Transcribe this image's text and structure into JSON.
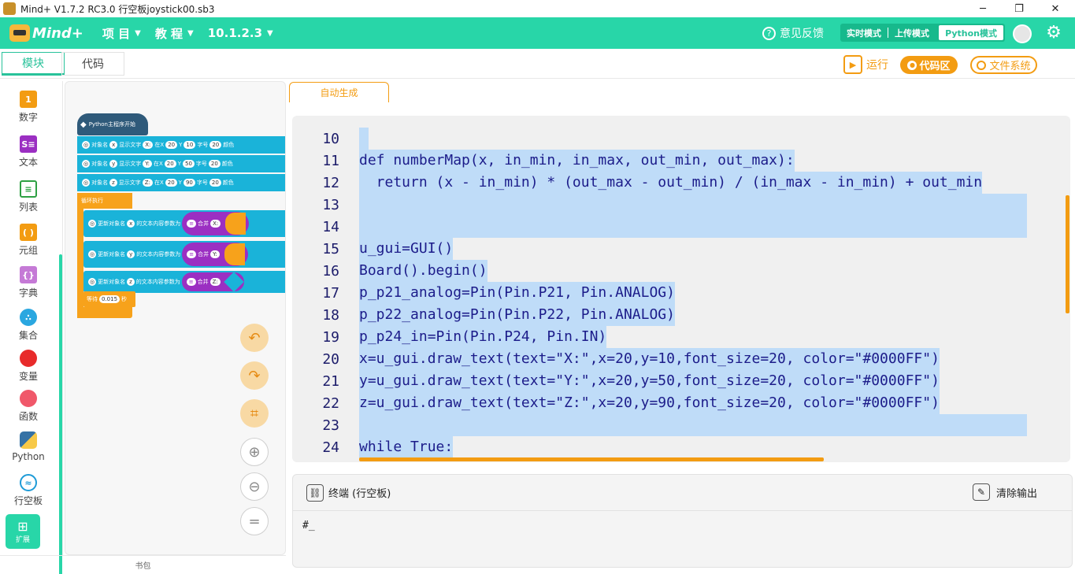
{
  "window": {
    "title": "Mind+ V1.7.2 RC3.0   行空板joystick00.sb3",
    "minimize": "─",
    "maximize": "❐",
    "close": "✕"
  },
  "menubar": {
    "logo_text": "Mind+",
    "project": "项 目",
    "tutorial": "教 程",
    "version": "10.1.2.3",
    "feedback": "意见反馈",
    "modes": [
      "实时模式",
      "上传模式",
      "Python模式"
    ],
    "active_mode": "Python模式"
  },
  "tabs": {
    "blocks": "模块",
    "code": "代码"
  },
  "toolbar": {
    "run": "运行",
    "code_area": "代码区",
    "file_system": "文件系统"
  },
  "categories": [
    {
      "label": "数字",
      "icon": "number-icon",
      "color": "#f39c12"
    },
    {
      "label": "文本",
      "icon": "text-icon",
      "color": "#9b2fc2"
    },
    {
      "label": "列表",
      "icon": "list-icon",
      "color": "#2ea043"
    },
    {
      "label": "元组",
      "icon": "tuple-icon",
      "color": "#f39c12"
    },
    {
      "label": "字典",
      "icon": "dict-icon",
      "color": "#c57ad6"
    },
    {
      "label": "集合",
      "icon": "set-icon",
      "color": "#2aa7e0"
    },
    {
      "label": "变量",
      "icon": "variable-icon",
      "color": "#e82b2b"
    },
    {
      "label": "函数",
      "icon": "function-icon",
      "color": "#f0586a"
    },
    {
      "label": "Python",
      "icon": "python-icon",
      "color": "#3572a5"
    },
    {
      "label": "行空板",
      "icon": "unihiker-icon",
      "color": "#1e9bd7"
    }
  ],
  "extension_label": "扩展",
  "blocks": {
    "hat": "Python主程序开始",
    "text_rows": [
      {
        "obj": "x",
        "label": "对象名",
        "show": "显示文字",
        "text": "X:",
        "at": "在X",
        "x": "20",
        "y_label": "Y",
        "y": "10",
        "size_label": "字号",
        "size": "20",
        "color_label": "颜色"
      },
      {
        "obj": "y",
        "label": "对象名",
        "show": "显示文字",
        "text": "Y:",
        "at": "在X",
        "x": "20",
        "y_label": "Y",
        "y": "50",
        "size_label": "字号",
        "size": "20",
        "color_label": "颜色"
      },
      {
        "obj": "z",
        "label": "对象名",
        "show": "显示文字",
        "text": "Z:",
        "at": "在X",
        "x": "20",
        "y_label": "Y",
        "y": "90",
        "size_label": "字号",
        "size": "20",
        "color_label": "颜色"
      }
    ],
    "loop": "循环执行",
    "update_rows": [
      {
        "label": "更新对象名",
        "obj": "x",
        "param": "的文本内容参数为",
        "merge": "合并",
        "val": "X:"
      },
      {
        "label": "更新对象名",
        "obj": "y",
        "param": "的文本内容参数为",
        "merge": "合并",
        "val": "Y:"
      },
      {
        "label": "更新对象名",
        "obj": "z",
        "param": "的文本内容参数为",
        "merge": "合并",
        "val": "Z:"
      }
    ],
    "wait_label": "等待",
    "wait_value": "0.015",
    "wait_unit": "秒"
  },
  "bookbag": "书包",
  "code_tab": "自动生成",
  "code_lines": [
    {
      "n": "10",
      "text": " "
    },
    {
      "n": "11",
      "text": "def numberMap(x, in_min, in_max, out_min, out_max):"
    },
    {
      "n": "12",
      "text": "  return (x - in_min) * (out_max - out_min) / (in_max - in_min) + out_min"
    },
    {
      "n": "13",
      "text": " "
    },
    {
      "n": "14",
      "text": " "
    },
    {
      "n": "15",
      "text": "u_gui=GUI()"
    },
    {
      "n": "16",
      "text": "Board().begin()"
    },
    {
      "n": "17",
      "text": "p_p21_analog=Pin(Pin.P21, Pin.ANALOG)"
    },
    {
      "n": "18",
      "text": "p_p22_analog=Pin(Pin.P22, Pin.ANALOG)"
    },
    {
      "n": "19",
      "text": "p_p24_in=Pin(Pin.P24, Pin.IN)"
    },
    {
      "n": "20",
      "text": "x=u_gui.draw_text(text=\"X:\",x=20,y=10,font_size=20, color=\"#0000FF\")"
    },
    {
      "n": "21",
      "text": "y=u_gui.draw_text(text=\"Y:\",x=20,y=50,font_size=20, color=\"#0000FF\")"
    },
    {
      "n": "22",
      "text": "z=u_gui.draw_text(text=\"Z:\",x=20,y=90,font_size=20, color=\"#0000FF\")"
    },
    {
      "n": "23",
      "text": " "
    },
    {
      "n": "24",
      "text": "while True:"
    }
  ],
  "terminal": {
    "title": "终端 (行空板)",
    "clear": "清除输出",
    "prompt": "#_"
  },
  "colors": {
    "accent": "#28d6a8",
    "orange": "#f39c12",
    "selection": "#bfdcf8"
  }
}
